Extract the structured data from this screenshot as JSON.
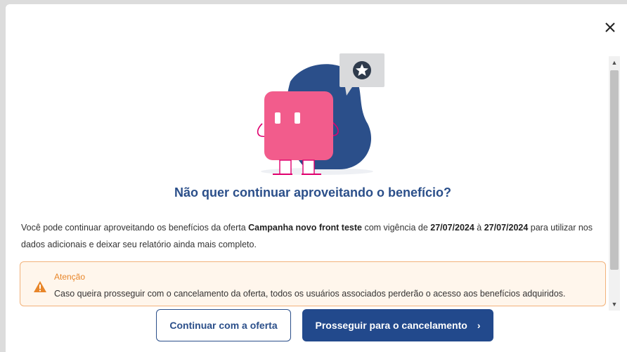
{
  "modal": {
    "title": "Não quer continuar aproveitando o benefício?",
    "close_icon": "close-icon",
    "description": {
      "p1": "Você pode continuar aproveitando os benefícios da oferta ",
      "offer_name": "Campanha novo front teste",
      "p2": " com vigência de ",
      "start_date": "27/07/2024",
      "p3": " à ",
      "end_date": "27/07/2024",
      "p4": " para utilizar nos dados adicionais e deixar seu relatório ainda mais completo."
    },
    "alert": {
      "icon": "warning-icon",
      "title": "Atenção",
      "text": "Caso queira prosseguir com o cancelamento da oferta, todos os usuários associados perderão o acesso aos benefícios adquiridos."
    },
    "buttons": {
      "continue_label": "Continuar com a oferta",
      "proceed_label": "Prosseguir para o cancelamento",
      "proceed_icon": "chevron-right-icon"
    }
  },
  "colors": {
    "primary": "#22498c",
    "title": "#2b4f8a",
    "warning": "#e8862a",
    "alert_bg": "#fff6ec",
    "alert_border": "#f2b27a",
    "mascot_pink": "#f25c8c",
    "blob_blue": "#2b4f8a"
  }
}
